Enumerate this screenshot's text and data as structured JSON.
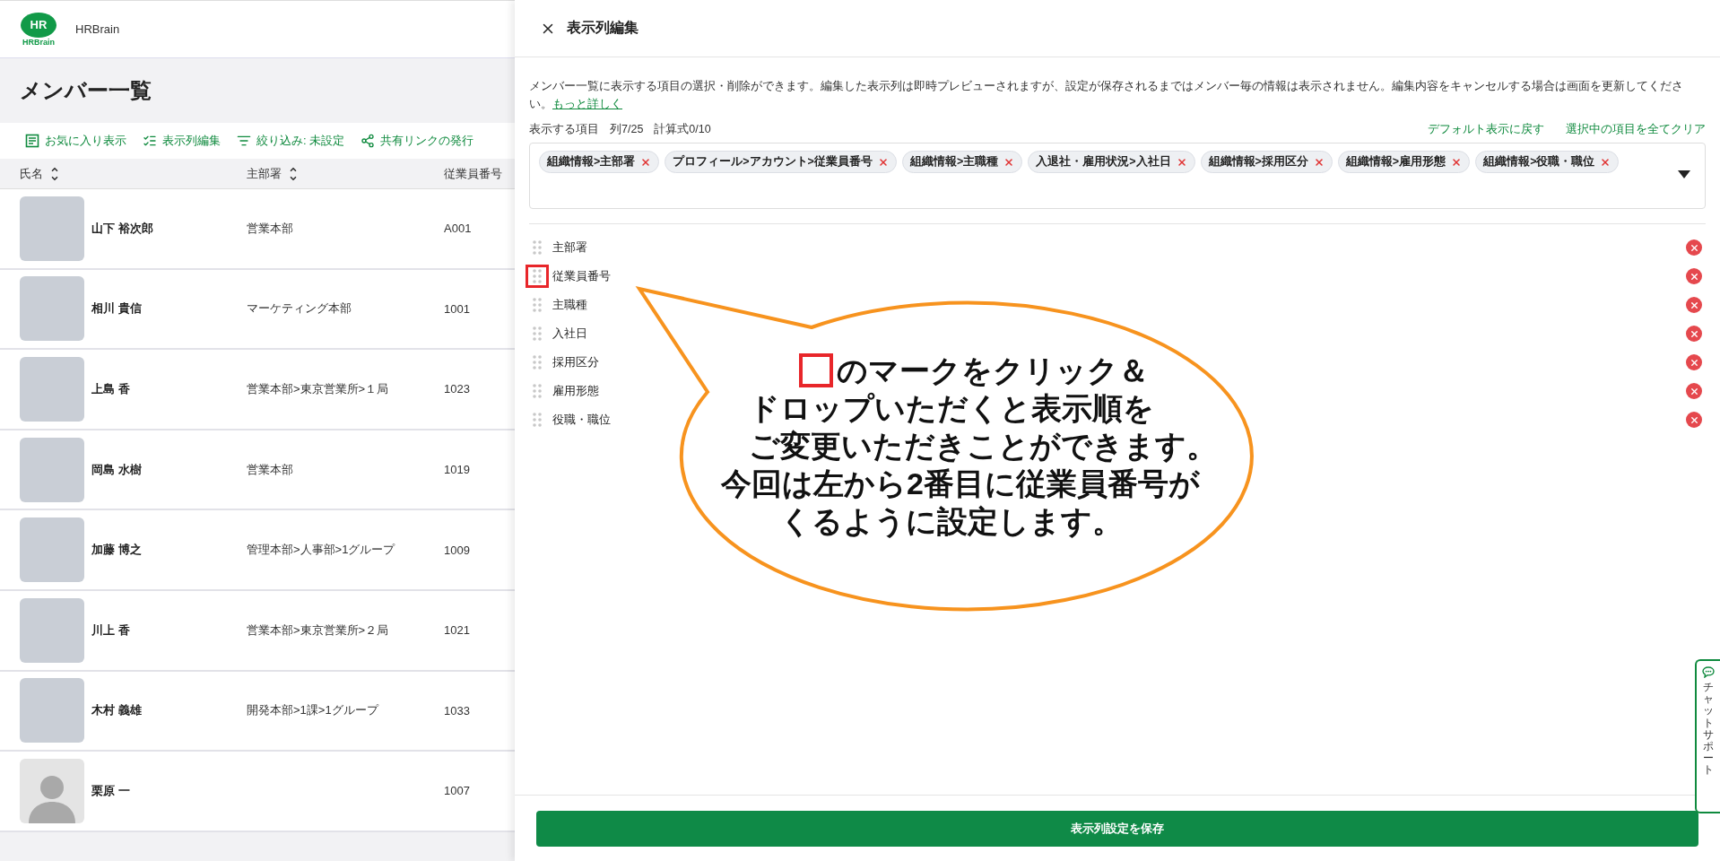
{
  "app": {
    "logo_mark": "HR",
    "logo_word": "HRBrain",
    "name": "HRBrain"
  },
  "page_title": "メンバー一覧",
  "toolbar": [
    {
      "kind": "favorite",
      "label": "お気に入り表示"
    },
    {
      "kind": "columns",
      "label": "表示列編集"
    },
    {
      "kind": "filter",
      "label": "絞り込み: 未設定"
    },
    {
      "kind": "share",
      "label": "共有リンクの発行"
    }
  ],
  "table": {
    "columns": [
      {
        "label": "氏名",
        "sortable": true
      },
      {
        "label": "主部署",
        "sortable": true
      },
      {
        "label": "従業員番号",
        "sortable": false
      }
    ],
    "rows": [
      {
        "kind": "photo",
        "name": "山下 裕次郎",
        "department": "営業本部",
        "employee_no": "A001"
      },
      {
        "kind": "photo",
        "name": "相川 貴信",
        "department": "マーケティング本部",
        "employee_no": "1001"
      },
      {
        "kind": "photo",
        "name": "上島 香",
        "department": "営業本部>東京営業所>１局",
        "employee_no": "1023"
      },
      {
        "kind": "photo",
        "name": "岡島 水樹",
        "department": "営業本部",
        "employee_no": "1019"
      },
      {
        "kind": "photo",
        "name": "加藤 博之",
        "department": "管理本部>人事部>1グループ",
        "employee_no": "1009"
      },
      {
        "kind": "photo",
        "name": "川上 香",
        "department": "営業本部>東京営業所>２局",
        "employee_no": "1021"
      },
      {
        "kind": "photo",
        "name": "木村 義雄",
        "department": "開発本部>1課>1グループ",
        "employee_no": "1033"
      },
      {
        "kind": "silhouette",
        "name": "栗原 一",
        "department": "",
        "employee_no": "1007"
      }
    ]
  },
  "panel": {
    "title": "表示列編集",
    "description": "メンバー一覧に表示する項目の選択・削除ができます。編集した表示列は即時プレビューされますが、設定が保存されるまではメンバー毎の情報は表示されません。編集内容をキャンセルする場合は画面を更新してください。",
    "more_link": "もっと詳しく",
    "items_label": "表示する項目",
    "column_count": "列7/25",
    "formula_count": "計算式0/10",
    "actions": [
      "デフォルト表示に戻す",
      "選択中の項目を全てクリア"
    ],
    "chips": [
      "組織情報>主部署",
      "プロフィール>アカウント>従業員番号",
      "組織情報>主職種",
      "入退社・雇用状況>入社日",
      "組織情報>採用区分",
      "組織情報>雇用形態",
      "組織情報>役職・職位"
    ],
    "columns": [
      {
        "label": "主部署",
        "highlighted": false
      },
      {
        "label": "従業員番号",
        "highlighted": true
      },
      {
        "label": "主職種",
        "highlighted": false
      },
      {
        "label": "入社日",
        "highlighted": false
      },
      {
        "label": "採用区分",
        "highlighted": false
      },
      {
        "label": "雇用形態",
        "highlighted": false
      },
      {
        "label": "役職・職位",
        "highlighted": false
      }
    ],
    "save_button": "表示列設定を保存"
  },
  "callout": {
    "lines": [
      "のマークをクリック＆",
      "ドロップいただくと表示順を",
      "ご変更いただきことができます。",
      "今回は左から2番目に従業員番号が",
      "くるように設定します。"
    ]
  },
  "chat_support": "チャットサポート"
}
